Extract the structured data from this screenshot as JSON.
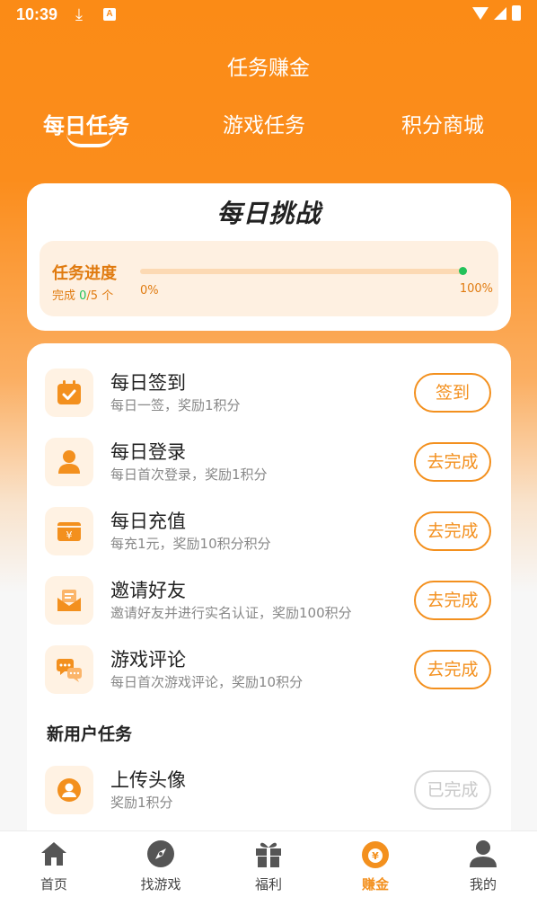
{
  "status_bar": {
    "time": "10:39"
  },
  "header": {
    "title": "任务赚金"
  },
  "tabs": [
    {
      "label": "每日任务",
      "active": true
    },
    {
      "label": "游戏任务",
      "active": false
    },
    {
      "label": "积分商城",
      "active": false
    }
  ],
  "challenge": {
    "title": "每日挑战",
    "progress_label": "任务进度",
    "progress_prefix": "完成 ",
    "progress_done": "0",
    "progress_suffix": "/5 个",
    "progress_fraction": 0,
    "min_label": "0%",
    "max_label": "100%"
  },
  "daily_tasks": [
    {
      "name": "每日签到",
      "desc": "每日一签，奖励1积分",
      "button": "签到",
      "icon": "calendar-check-icon"
    },
    {
      "name": "每日登录",
      "desc": "每日首次登录，奖励1积分",
      "button": "去完成",
      "icon": "user-icon"
    },
    {
      "name": "每日充值",
      "desc": "每充1元，奖励10积分积分",
      "button": "去完成",
      "icon": "wallet-yuan-icon"
    },
    {
      "name": "邀请好友",
      "desc": "邀请好友并进行实名认证，奖励100积分",
      "button": "去完成",
      "icon": "envelope-icon"
    },
    {
      "name": "游戏评论",
      "desc": "每日首次游戏评论，奖励10积分",
      "button": "去完成",
      "icon": "chat-icon"
    }
  ],
  "new_user_section": {
    "title": "新用户任务",
    "tasks": [
      {
        "name": "上传头像",
        "desc": "奖励1积分",
        "button": "已完成",
        "icon": "avatar-icon"
      }
    ]
  },
  "bottom_nav": [
    {
      "label": "首页",
      "icon": "home-icon",
      "active": false
    },
    {
      "label": "找游戏",
      "icon": "compass-icon",
      "active": false
    },
    {
      "label": "福利",
      "icon": "gift-icon",
      "active": false
    },
    {
      "label": "赚金",
      "icon": "money-bag-icon",
      "active": true
    },
    {
      "label": "我的",
      "icon": "profile-icon",
      "active": false
    }
  ],
  "colors": {
    "primary": "#fb8b16",
    "accent": "#f3901e",
    "progress_dot": "#23c25a",
    "icon_bg": "#fff2e3",
    "nav_inactive": "#555555"
  }
}
